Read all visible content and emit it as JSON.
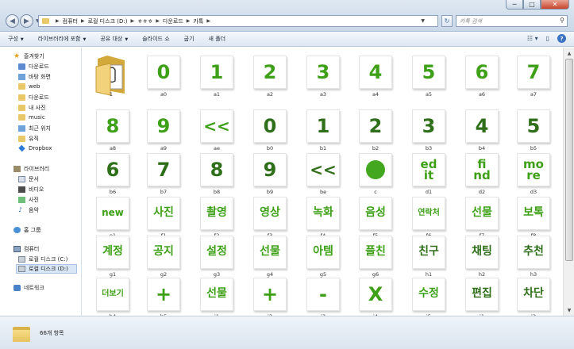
{
  "window": {
    "breadcrumb": [
      "컴퓨터",
      "로컬 디스크 (D:)",
      "ㅎㅎㅎ",
      "다운로드",
      "카톡"
    ],
    "search_placeholder": "카톡 검색",
    "minimize": "─",
    "maximize": "□",
    "close": "✕"
  },
  "toolbar": {
    "organize": "구성",
    "include_library": "라이브러리에 포함",
    "share_with": "공유 대상",
    "slideshow": "슬라이드 쇼",
    "burn": "굽기",
    "new_folder": "새 폴더"
  },
  "navpane": {
    "favorites": "즐겨찾기",
    "fav_items": [
      "다운로드",
      "바탕 화면",
      "web",
      "다운로드",
      "내 사진",
      "music",
      "최근 위치",
      "유직",
      "Dropbox"
    ],
    "libraries": "라이브러리",
    "lib_items": [
      "문서",
      "비디오",
      "사진",
      "음악"
    ],
    "homegroup": "홈 그룹",
    "computer": "컴퓨터",
    "drives": [
      "로컬 디스크 (C:)",
      "로컬 디스크 (D:)"
    ],
    "network": "네트워크"
  },
  "files": [
    {
      "name": "1",
      "glyph": "",
      "kind": "folder"
    },
    {
      "name": "a0",
      "glyph": "0"
    },
    {
      "name": "a1",
      "glyph": "1"
    },
    {
      "name": "a2",
      "glyph": "2"
    },
    {
      "name": "a3",
      "glyph": "3"
    },
    {
      "name": "a4",
      "glyph": "4"
    },
    {
      "name": "a5",
      "glyph": "5"
    },
    {
      "name": "a6",
      "glyph": "6"
    },
    {
      "name": "a7",
      "glyph": "7"
    },
    {
      "name": "a8",
      "glyph": "8"
    },
    {
      "name": "a9",
      "glyph": "9"
    },
    {
      "name": "ae",
      "glyph": "<<"
    },
    {
      "name": "b0",
      "glyph": "0",
      "dark": true
    },
    {
      "name": "b1",
      "glyph": "1",
      "dark": true
    },
    {
      "name": "b2",
      "glyph": "2",
      "dark": true
    },
    {
      "name": "b3",
      "glyph": "3",
      "dark": true
    },
    {
      "name": "b4",
      "glyph": "4",
      "dark": true
    },
    {
      "name": "b5",
      "glyph": "5",
      "dark": true
    },
    {
      "name": "b6",
      "glyph": "6",
      "dark": true
    },
    {
      "name": "b7",
      "glyph": "7",
      "dark": true
    },
    {
      "name": "b8",
      "glyph": "8",
      "dark": true
    },
    {
      "name": "b9",
      "glyph": "9",
      "dark": true
    },
    {
      "name": "be",
      "glyph": "<<",
      "dark": true
    },
    {
      "name": "c",
      "glyph": "",
      "kind": "dot"
    },
    {
      "name": "d1",
      "glyph": "ed\nit"
    },
    {
      "name": "d2",
      "glyph": "fi\nnd"
    },
    {
      "name": "d3",
      "glyph": "mo\nre"
    },
    {
      "name": "e1",
      "glyph": "new"
    },
    {
      "name": "f1",
      "glyph": "사진"
    },
    {
      "name": "f2",
      "glyph": "촬영"
    },
    {
      "name": "f3",
      "glyph": "영상"
    },
    {
      "name": "f4",
      "glyph": "녹화"
    },
    {
      "name": "f5",
      "glyph": "음성"
    },
    {
      "name": "f6",
      "glyph": "연락처"
    },
    {
      "name": "f7",
      "glyph": "선물"
    },
    {
      "name": "f8",
      "glyph": "보톡"
    },
    {
      "name": "g1",
      "glyph": "계정"
    },
    {
      "name": "g2",
      "glyph": "공지"
    },
    {
      "name": "g3",
      "glyph": "설정"
    },
    {
      "name": "g4",
      "glyph": "선물"
    },
    {
      "name": "g5",
      "glyph": "아템"
    },
    {
      "name": "g6",
      "glyph": "플친"
    },
    {
      "name": "h1",
      "glyph": "친구",
      "dark": true
    },
    {
      "name": "h2",
      "glyph": "채팅",
      "dark": true
    },
    {
      "name": "h3",
      "glyph": "추천",
      "dark": true
    },
    {
      "name": "h4",
      "glyph": "더보기"
    },
    {
      "name": "h5",
      "glyph": "+"
    },
    {
      "name": "i1",
      "glyph": "선물"
    },
    {
      "name": "i2",
      "glyph": "+"
    },
    {
      "name": "i3",
      "glyph": "-"
    },
    {
      "name": "i4",
      "glyph": "X"
    },
    {
      "name": "i5",
      "glyph": "수정"
    },
    {
      "name": "j1",
      "glyph": "편집",
      "dark": true
    },
    {
      "name": "j2",
      "glyph": "차단",
      "dark": true
    }
  ],
  "status": {
    "count": "66개 항목"
  }
}
